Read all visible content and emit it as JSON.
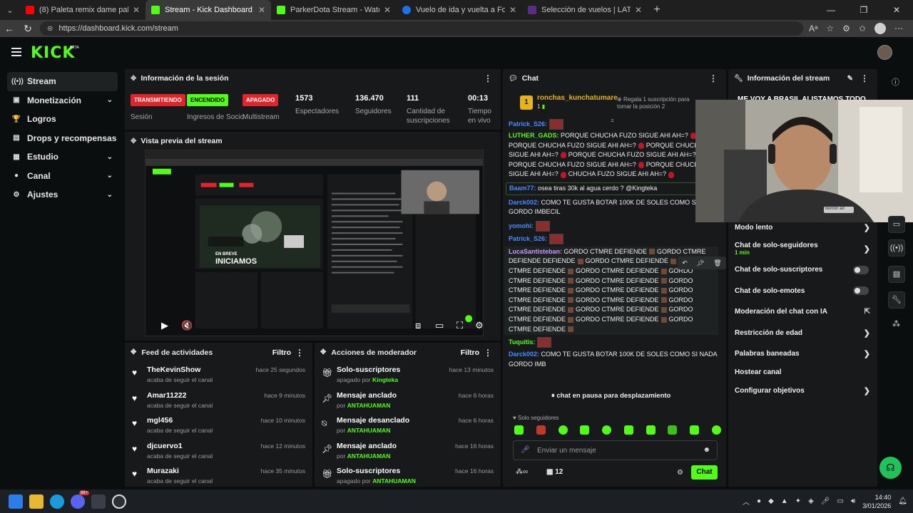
{
  "browser": {
    "tabs": [
      {
        "title": "(8) Paleta remix dame paleta paleta",
        "color": "#ff0000"
      },
      {
        "title": "Stream - Kick Dashboard",
        "color": "#53fc18"
      },
      {
        "title": "ParkerDota Stream - Watch Live on",
        "color": "#53fc18"
      },
      {
        "title": "Vuelo de ida y vuelta a Fortaleza |",
        "color": "#1a73e8"
      },
      {
        "title": "Selección de vuelos | LATAM Airlin",
        "color": "#5a2d82"
      }
    ],
    "url": "https://dashboard.kick.com/stream"
  },
  "header": {
    "logo": "KICK",
    "beta": "BETA"
  },
  "sidebar": {
    "items": [
      {
        "label": "Stream",
        "icon": "broadcast-icon",
        "chevron": false
      },
      {
        "label": "Monetización",
        "icon": "money-icon",
        "chevron": true
      },
      {
        "label": "Logros",
        "icon": "trophy-icon",
        "chevron": false
      },
      {
        "label": "Drops y recompensas",
        "icon": "gift-icon",
        "chevron": false
      },
      {
        "label": "Estudio",
        "icon": "studio-icon",
        "chevron": true
      },
      {
        "label": "Canal",
        "icon": "person-icon",
        "chevron": true
      },
      {
        "label": "Ajustes",
        "icon": "gear-icon",
        "chevron": true
      }
    ]
  },
  "session": {
    "title": "Información de la sesión",
    "stats": [
      {
        "badge": "TRANSMITIENDO",
        "label": "Sesión"
      },
      {
        "badge": "ENCENDIDO",
        "label": "Ingresos de Socio"
      },
      {
        "badge": "APAGADO",
        "label": "Multistream"
      },
      {
        "value": "1573",
        "label": "Espectadores"
      },
      {
        "value": "136.470",
        "label": "Seguidores"
      },
      {
        "value": "111",
        "label": "Cantidad de suscripciones"
      },
      {
        "value": "00:13",
        "label": "Tiempo en vivo"
      }
    ]
  },
  "preview": {
    "title": "Vista previa del stream",
    "overlay_top": "EN BREVE",
    "overlay_main": "INICIAMOS"
  },
  "activity": {
    "title": "Feed de actividades",
    "filter": "Filtro",
    "items": [
      {
        "name": "TheKevinShow",
        "sub": "acaba de seguir el canal",
        "time": "hace 25 segundos"
      },
      {
        "name": "Amar11222",
        "sub": "acaba de seguir el canal",
        "time": "hace 9 minutos"
      },
      {
        "name": "mgl456",
        "sub": "acaba de seguir el canal",
        "time": "hace 10 minutos"
      },
      {
        "name": "djcuervo1",
        "sub": "acaba de seguir el canal",
        "time": "hace 12 minutos"
      },
      {
        "name": "Murazaki",
        "sub": "acaba de seguir el canal",
        "time": "hace 35 minutos"
      }
    ]
  },
  "moderator": {
    "title": "Acciones de moderador",
    "filter": "Filtro",
    "items": [
      {
        "name": "Solo-suscriptores",
        "sub_prefix": "apagado por",
        "by": "Kingteka",
        "time": "hace 13 minutos",
        "icon": "gift-icon"
      },
      {
        "name": "Mensaje anclado",
        "sub_prefix": "por",
        "by": "ANTAHUAMAN",
        "time": "hace 6 horas",
        "icon": "pin-icon"
      },
      {
        "name": "Mensaje desanclado",
        "sub_prefix": "por",
        "by": "ANTAHUAMAN",
        "time": "hace 6 horas",
        "icon": "unpin-icon"
      },
      {
        "name": "Mensaje anclado",
        "sub_prefix": "por",
        "by": "ANTAHUAMAN",
        "time": "hace 16 horas",
        "icon": "pin-icon"
      },
      {
        "name": "Solo-suscriptores",
        "sub_prefix": "apagado por",
        "by": "ANTAHUAMAN",
        "time": "hace 16 horas",
        "icon": "gift-icon"
      }
    ]
  },
  "chat": {
    "title": "Chat",
    "top_user": "ronchas_kunchatumare",
    "top_count": "1",
    "gift_text": "Regala 1 suscripción para tomar la posición 2",
    "paused": "chat en pausa para desplazamiento",
    "followers_only": "Solo seguidores",
    "placeholder": "Enviar un mensaje",
    "viewer_count": "12",
    "send": "Chat",
    "msgs": {
      "u1": "Patrick_S26:",
      "u2": "LUTHER_GADS:",
      "t2": "PORQUE CHUCHA FUZO SIGUE AHI AH=?",
      "t2b": "PORQUE CHUCHA FUZO SIGUE AHI AH=?",
      "t2c": "PORQUE CHUCHA FUZO SIGUE AHI AH=?",
      "t2d": "PORQUE CHUCHA FUZO SIGUE AHI AH=?",
      "t2e": "PORQUE CHUCHA FUZO SIGUE AHI AH=?",
      "t2f": "PORQUE CHUCHA FUZO SIGUE AHI AH=?",
      "t2g": "CHUCHA FUZO SIGUE AHI AH=?",
      "u3": "Baam77:",
      "t3": "osea tiras 30k al agua cerdo ? @Kingteka",
      "u4": "Darck002:",
      "t4": "COMO TE GUSTA BOTAR 100K DE SOLES COMO SI NADA GORDO IMBECIL",
      "u5": "yomohi:",
      "u6": "Patrick_S26:",
      "u7": "LucaSantisteban:",
      "t7": "GORDO CTMRE DEFIENDE",
      "t7x": "DEFIENDE",
      "t7y": "GORDO CTMRE",
      "u8": "Tuquitis:",
      "u9": "Darck002:",
      "t9": "COMO TE GUSTA BOTAR 100K DE SOLES COMO SI NADA GORDO IMB"
    }
  },
  "stream_info": {
    "title": "Información del stream",
    "banner": "ME VOY A BRASIL ALISTAMOS TODO",
    "rows": [
      {
        "label": "Modo lento",
        "control": "chevron"
      },
      {
        "label": "Chat de solo-seguidores",
        "sub": "1 min",
        "control": "chevron"
      },
      {
        "label": "Chat de solo-suscriptores",
        "control": "toggle"
      },
      {
        "label": "Chat de solo-emotes",
        "control": "toggle"
      },
      {
        "label": "Moderación del chat con IA",
        "control": "external"
      },
      {
        "label": "Restricción de edad",
        "control": "chevron"
      },
      {
        "label": "Palabras baneadas",
        "control": "chevron"
      },
      {
        "label": "Hostear canal",
        "control": "none"
      },
      {
        "label": "Configurar objetivos",
        "control": "chevron"
      }
    ]
  },
  "webcam": {
    "shirt_text": "demon ad"
  },
  "taskbar": {
    "time": "14:40",
    "date": "3/01/2026",
    "badge": "99+"
  },
  "colors": {
    "kick_green": "#53fc18",
    "live_red": "#e2252b",
    "panel": "#17191a"
  }
}
